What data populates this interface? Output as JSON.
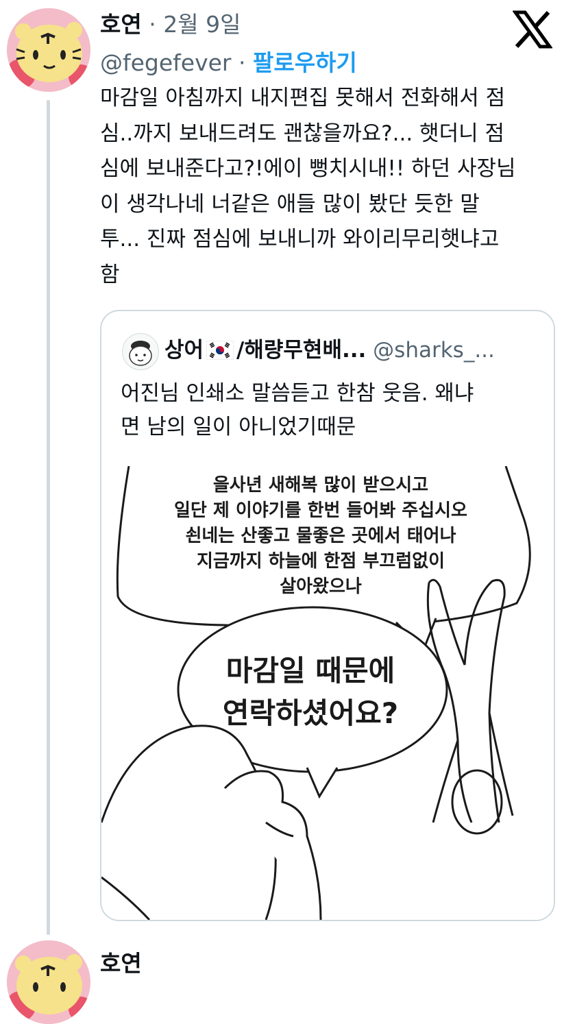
{
  "tweet": {
    "author_name": "호연",
    "separator": "·",
    "date": "2월 9일",
    "handle": "@fegefever",
    "follow_label": "팔로우하기",
    "text": "마감일 아침까지 내지편집 못해서 전화해서 점\n심..까지 보내드려도 괜찮을까요?... 햇더니 점\n심에 보내준다고?!에이 뻥치시내!! 하던 사장님\n이 생각나네 너같은 애들 많이 봤단 듯한 말\n투... 진짜 점심에 보내니까 와이리무리햇냐고\n함"
  },
  "quote": {
    "name_prefix": "상어",
    "name_suffix": "/해량무현배...",
    "handle": "@sharks_...",
    "text": "어진님 인쇄소 말씀듣고 한참 웃음.  왜냐\n면 남의 일이 아니었기때문",
    "comic": {
      "bubble1": "을사년 새해복 많이 받으시고\n일단 제 이야기를 한번 들어봐 주십시오\n쇤네는 산좋고 물좋은 곳에서 태어나\n지금까지 하늘에 한점 부끄럼없이\n살아왔으나",
      "bubble2": "마감일 때문에\n연락하셨어요?"
    }
  },
  "reply": {
    "author_name": "호연"
  },
  "icons": {
    "x_logo": "x-logo-icon",
    "flag": "korea-flag-icon"
  },
  "colors": {
    "link": "#1d9bf0",
    "secondary_text": "#536471",
    "border": "#cfd9de"
  }
}
